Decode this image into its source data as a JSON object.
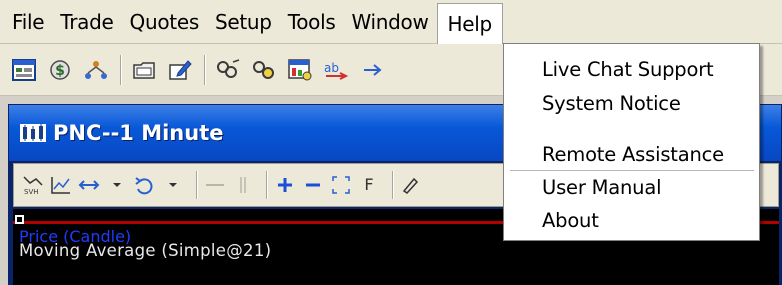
{
  "menubar": {
    "items": [
      "File",
      "Trade",
      "Quotes",
      "Setup",
      "Tools",
      "Window",
      "Help"
    ]
  },
  "toolbar": {
    "icons": [
      "window-icon",
      "dollar-icon",
      "network-icon",
      "folder-icon",
      "edit-icon",
      "link-icon",
      "link-icon",
      "chart-icon",
      "order-icon",
      "order-icon"
    ]
  },
  "chart_window": {
    "title": "PNC--1 Minute",
    "toolbar_text": "F",
    "indicator_name": "Price (Candle)",
    "indicator_label": "Moving Average (Simple@21)"
  },
  "help_menu": {
    "items": [
      "Live Chat Support",
      "System Notice",
      "Remote Assistance",
      "User Manual",
      "About"
    ]
  },
  "colors": {
    "menubar_bg": "#ece9d8",
    "titlebar_blue": "#0858d8",
    "chart_bg": "#000000",
    "price_line": "#b00000"
  }
}
